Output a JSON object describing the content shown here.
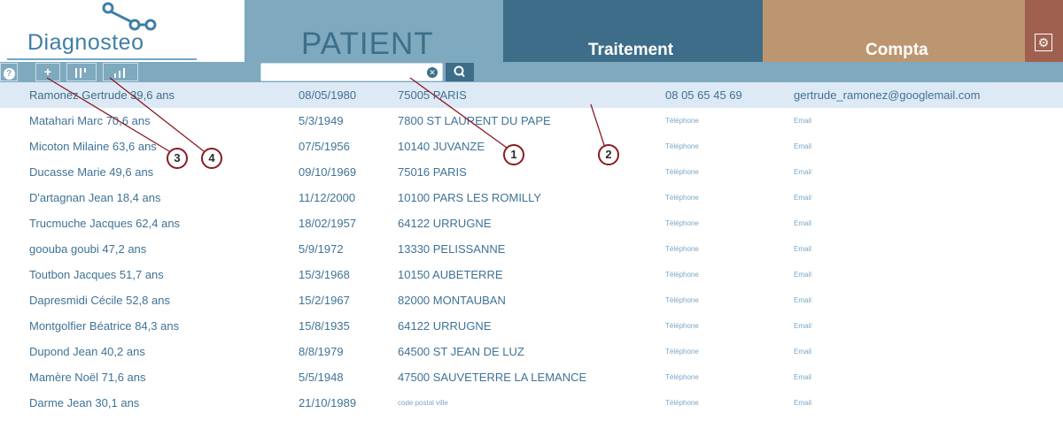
{
  "logo": {
    "text": "Diagnosteo"
  },
  "tabs": {
    "patient": "PATIENT",
    "traitement": "Traitement",
    "compta": "Compta"
  },
  "toolbar": {
    "help_icon": "question-icon",
    "add_label": "+",
    "calendar_icon": "calendar-bars-icon",
    "stats_icon": "bar-chart-icon"
  },
  "search": {
    "placeholder": "",
    "value": ""
  },
  "patients": [
    {
      "name": "Ramonez Gertrude 39,6 ans",
      "dob": "08/05/1980",
      "city": "75005 PARIS",
      "phone": "08 05 65 45 69",
      "email": "gertrude_ramonez@googlemail.com",
      "selected": true
    },
    {
      "name": "Matahari Marc 70,6 ans",
      "dob": "5/3/1949",
      "city": "7800 ST LAURENT DU PAPE",
      "phone": "Téléphone",
      "email": "Email"
    },
    {
      "name": "Micoton Milaine 63,6 ans",
      "dob": "07/5/1956",
      "city": "10140 JUVANZE",
      "phone": "Téléphone",
      "email": "Email"
    },
    {
      "name": "Ducasse Marie 49,6 ans",
      "dob": "09/10/1969",
      "city": "75016 PARIS",
      "phone": "Téléphone",
      "email": "Email"
    },
    {
      "name": "D'artagnan Jean 18,4 ans",
      "dob": "11/12/2000",
      "city": "10100 PARS LES ROMILLY",
      "phone": "Téléphone",
      "email": "Email"
    },
    {
      "name": "Trucmuche Jacques 62,4 ans",
      "dob": "18/02/1957",
      "city": "64122 URRUGNE",
      "phone": "Téléphone",
      "email": "Email"
    },
    {
      "name": "goouba goubi 47,2 ans",
      "dob": "5/9/1972",
      "city": "13330 PELISSANNE",
      "phone": "Téléphone",
      "email": "Email"
    },
    {
      "name": "Toutbon Jacques 51,7 ans",
      "dob": "15/3/1968",
      "city": "10150 AUBETERRE",
      "phone": "Téléphone",
      "email": "Email"
    },
    {
      "name": "Dapresmidi Cécile 52,8 ans",
      "dob": "15/2/1967",
      "city": "82000 MONTAUBAN",
      "phone": "Téléphone",
      "email": "Email"
    },
    {
      "name": "Montgolfier Béatrice 84,3 ans",
      "dob": "15/8/1935",
      "city": "64122 URRUGNE",
      "phone": "Téléphone",
      "email": "Email"
    },
    {
      "name": "Dupond Jean 40,2 ans",
      "dob": "8/8/1979",
      "city": "64500 ST JEAN DE LUZ",
      "phone": "Téléphone",
      "email": "Email"
    },
    {
      "name": "Mamère Noël 71,6 ans",
      "dob": "5/5/1948",
      "city": "47500 SAUVETERRE LA LEMANCE",
      "phone": "Téléphone",
      "email": "Email"
    },
    {
      "name": "Darme Jean 30,1 ans",
      "dob": "21/10/1989",
      "city": "code postal ville",
      "phone": "Téléphone",
      "email": "Email"
    }
  ],
  "callouts": [
    "1",
    "2",
    "3",
    "4"
  ],
  "colors": {
    "patient_tab": "#7fa9be",
    "traitement_tab": "#3d6d89",
    "compta_tab": "#bc9670",
    "settings_tab": "#a06050",
    "callout_ring": "#8a1a24"
  }
}
